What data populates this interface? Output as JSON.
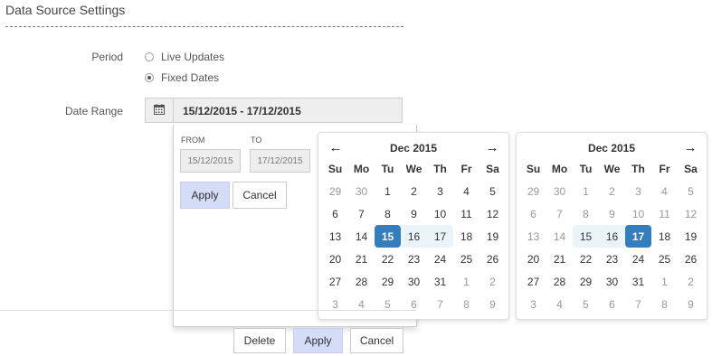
{
  "page": {
    "section_title": "Data Source Settings"
  },
  "form": {
    "period_label": "Period",
    "period_options": [
      {
        "label": "Live Updates",
        "checked": false
      },
      {
        "label": "Fixed Dates",
        "checked": true
      }
    ],
    "date_range_label": "Date Range",
    "date_range_value": "15/12/2015 - 17/12/2015",
    "calendar_icon": "calendar-icon"
  },
  "picker": {
    "from_label": "FROM",
    "to_label": "TO",
    "from_value": "15/12/2015",
    "to_value": "17/12/2015",
    "apply_label": "Apply",
    "cancel_label": "Cancel",
    "left_calendar": {
      "month_title": "Dec 2015",
      "prev_icon": "arrow-left-icon",
      "next_icon": "arrow-right-icon"
    },
    "right_calendar": {
      "month_title": "Dec 2015",
      "next_icon": "arrow-right-icon"
    },
    "weekdays": [
      "Su",
      "Mo",
      "Tu",
      "We",
      "Th",
      "Fr",
      "Sa"
    ],
    "days": [
      {
        "d": "29",
        "off": true
      },
      {
        "d": "30",
        "off": true
      },
      {
        "d": "1"
      },
      {
        "d": "2"
      },
      {
        "d": "3"
      },
      {
        "d": "4"
      },
      {
        "d": "5"
      },
      {
        "d": "6"
      },
      {
        "d": "7"
      },
      {
        "d": "8"
      },
      {
        "d": "9"
      },
      {
        "d": "10"
      },
      {
        "d": "11"
      },
      {
        "d": "12"
      },
      {
        "d": "13"
      },
      {
        "d": "14"
      },
      {
        "d": "15"
      },
      {
        "d": "16"
      },
      {
        "d": "17"
      },
      {
        "d": "18"
      },
      {
        "d": "19"
      },
      {
        "d": "20"
      },
      {
        "d": "21"
      },
      {
        "d": "22"
      },
      {
        "d": "23"
      },
      {
        "d": "24"
      },
      {
        "d": "25"
      },
      {
        "d": "26"
      },
      {
        "d": "27"
      },
      {
        "d": "28"
      },
      {
        "d": "29"
      },
      {
        "d": "30"
      },
      {
        "d": "31"
      },
      {
        "d": "1",
        "off": true
      },
      {
        "d": "2",
        "off": true
      },
      {
        "d": "3",
        "off": true
      },
      {
        "d": "4",
        "off": true
      },
      {
        "d": "5",
        "off": true
      },
      {
        "d": "6",
        "off": true
      },
      {
        "d": "7",
        "off": true
      },
      {
        "d": "8",
        "off": true
      },
      {
        "d": "9",
        "off": true
      }
    ],
    "range_start": "15",
    "range_end": "17",
    "accent_color": "#357ebd",
    "range_color": "#ebf4f8"
  },
  "footer": {
    "delete_label": "Delete",
    "apply_label": "Apply",
    "cancel_label": "Cancel"
  }
}
